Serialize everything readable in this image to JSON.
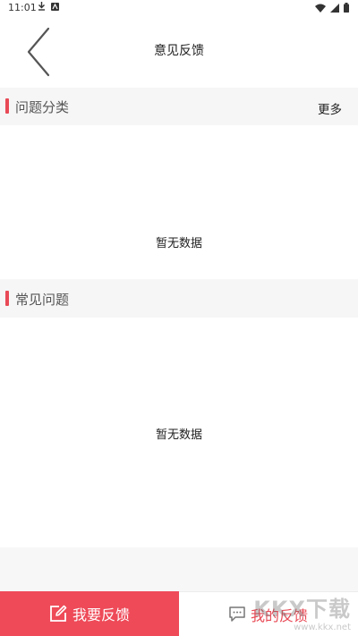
{
  "status_bar": {
    "time": "11:01",
    "left_icons": [
      "download-icon",
      "a11y-icon"
    ],
    "right_icons": [
      "wifi-icon",
      "signal-icon",
      "battery-icon"
    ]
  },
  "header": {
    "title": "意见反馈",
    "back_icon": "chevron-left-icon"
  },
  "category_section": {
    "title": "问题分类",
    "more_label": "更多",
    "empty_text": "暂无数据"
  },
  "faq_section": {
    "title": "常见问题",
    "empty_text": "暂无数据"
  },
  "bottom_tabs": {
    "submit_label": "我要反馈",
    "submit_icon": "edit-icon",
    "mine_label": "我的反馈",
    "mine_icon": "chat-icon"
  },
  "watermark": {
    "brand": "KKX下载",
    "url": "www.kkx.net"
  },
  "colors": {
    "accent": "#e84a56",
    "submit_bg": "#ee4a58",
    "section_bg": "#f6f6f6"
  }
}
